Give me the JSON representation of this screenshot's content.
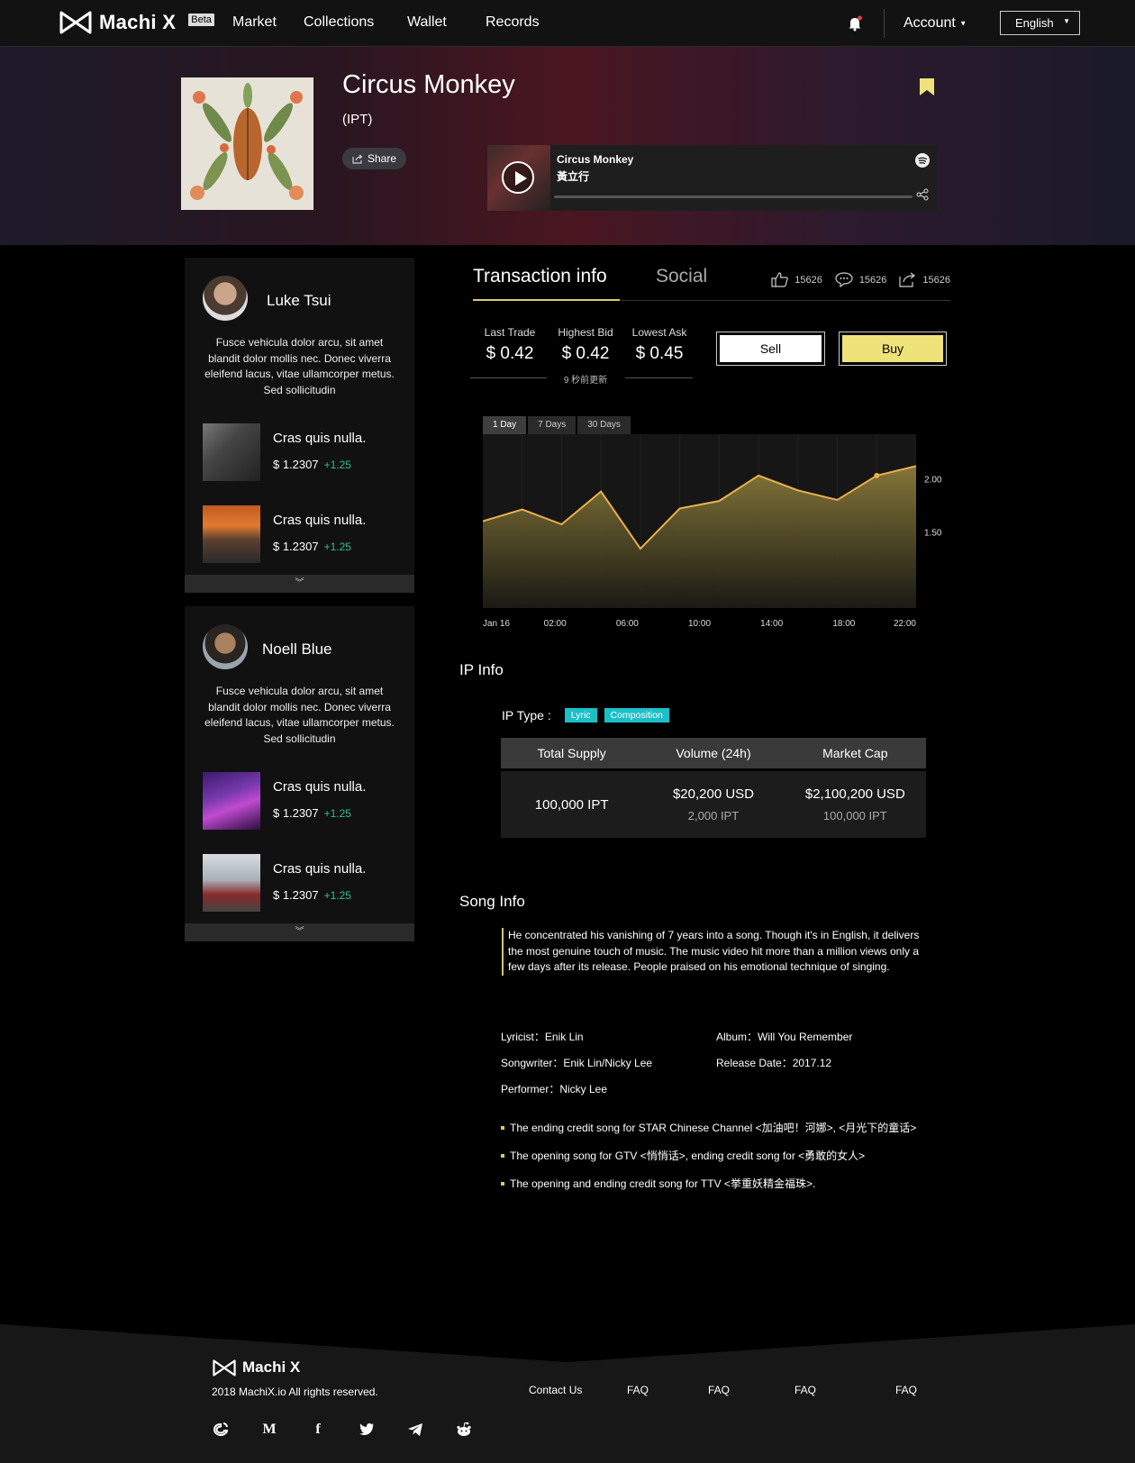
{
  "nav": {
    "brand": "Machi X",
    "beta": "Beta",
    "links": [
      "Market",
      "Collections",
      "Wallet",
      "Records"
    ],
    "account": "Account",
    "language": "English"
  },
  "hero": {
    "title": "Circus Monkey",
    "subtitle": "(IPT)",
    "share": "Share",
    "player_title": "Circus Monkey",
    "player_artist": "黃立行"
  },
  "sidebar": {
    "cards": [
      {
        "name": "Luke Tsui",
        "bio": "Fusce vehicula dolor arcu, sit amet blandit dolor mollis nec. Donec viverra eleifend lacus, vitae ullamcorper metus. Sed sollicitudin",
        "items": [
          {
            "title": "Cras quis nulla.",
            "price": "$ 1.2307",
            "change": "+1.25"
          },
          {
            "title": "Cras quis nulla.",
            "price": "$ 1.2307",
            "change": "+1.25"
          }
        ]
      },
      {
        "name": "Noell Blue",
        "bio": "Fusce vehicula dolor arcu, sit amet blandit dolor mollis nec. Donec viverra eleifend lacus, vitae ullamcorper metus. Sed sollicitudin",
        "items": [
          {
            "title": "Cras quis nulla.",
            "price": "$ 1.2307",
            "change": "+1.25"
          },
          {
            "title": "Cras quis nulla.",
            "price": "$ 1.2307",
            "change": "+1.25"
          }
        ]
      }
    ]
  },
  "tabs": {
    "active": "Transaction info",
    "inactive": "Social",
    "likes": "15626",
    "comments": "15626",
    "shares": "15626"
  },
  "stats": {
    "last_trade_label": "Last Trade",
    "last_trade": "$ 0.42",
    "highest_bid_label": "Highest Bid",
    "highest_bid": "$ 0.42",
    "lowest_ask_label": "Lowest Ask",
    "lowest_ask": "$ 0.45",
    "updated": "9 秒前更新",
    "sell": "Sell",
    "buy": "Buy"
  },
  "ranges": [
    "1 Day",
    "7 Days",
    "30 Days"
  ],
  "chart_data": {
    "type": "area",
    "x": [
      "Jan 16",
      "",
      "02:00",
      "",
      "06:00",
      "",
      "10:00",
      "",
      "14:00",
      "",
      "18:00",
      "",
      "22:00"
    ],
    "xticks": [
      "Jan 16",
      "02:00",
      "06:00",
      "10:00",
      "14:00",
      "18:00",
      "22:00"
    ],
    "values": [
      1.6,
      1.71,
      1.57,
      1.88,
      1.34,
      1.72,
      1.79,
      2.03,
      1.89,
      1.8,
      2.03,
      2.12
    ],
    "yticks": [
      "2.00",
      "1.50"
    ],
    "ylim": [
      0.78,
      2.42
    ],
    "color": "#e9b04a"
  },
  "ip_info": {
    "title": "IP Info",
    "type_label": "IP Type :",
    "tags": [
      "Lyric",
      "Composition"
    ],
    "headers": [
      "Total Supply",
      "Volume (24h)",
      "Market Cap"
    ],
    "supply": "100,000 IPT",
    "volume": "$20,200 USD",
    "volume_ipt": "2,000 IPT",
    "cap": "$2,100,200 USD",
    "cap_ipt": "100,000 IPT"
  },
  "song_info": {
    "title": "Song Info",
    "desc": "He concentrated his vanishing of 7 years into a song. Though it's in English, it delivers the most genuine touch of music. The music video hit more than a million views only a few days after its release. People praised on his emotional technique of singing.",
    "lyricist": "Lyricist：Enik Lin",
    "album": "Album：Will You Remember",
    "songwriter": "Songwriter：Enik Lin/Nicky Lee",
    "release": "Release Date：2017.12",
    "performer": "Performer：Nicky Lee",
    "notes": [
      "The ending credit song for STAR Chinese Channel <加油吧！河娜>, <月光下的童话>",
      "The opening song for GTV <悄悄话>, ending credit song for <勇敢的女人>",
      "The opening and ending credit song for TTV <挙重妖精金福珠>."
    ]
  },
  "footer": {
    "brand": "Machi X",
    "copyright": "2018 MachiX.io All rights reserved.",
    "links": [
      "Contact Us",
      "FAQ",
      "FAQ",
      "FAQ",
      "FAQ"
    ],
    "social_m": "M",
    "social_f": "f"
  }
}
